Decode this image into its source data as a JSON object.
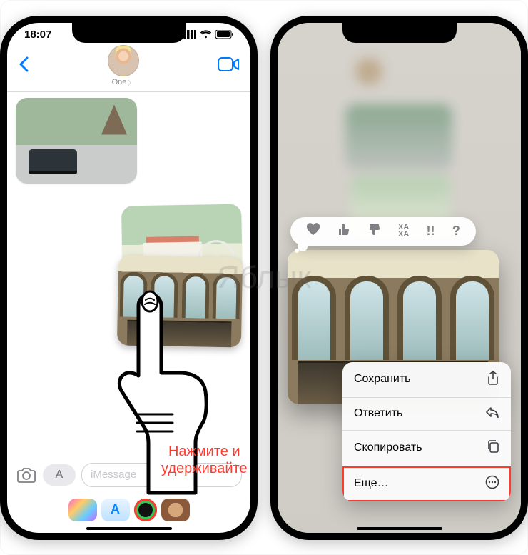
{
  "statusbar": {
    "time": "18:07"
  },
  "nav": {
    "contact_name": "One"
  },
  "input": {
    "placeholder": "iMessage"
  },
  "appstore_glyph": "A",
  "hint": {
    "line1": "Нажмите и",
    "line2": "удерживайте"
  },
  "tapback": {
    "haha": "XA\nXA",
    "emphasis": "!!",
    "question": "?"
  },
  "menu": {
    "save": "Сохранить",
    "reply": "Ответить",
    "copy": "Скопировать",
    "more": "Еще…"
  },
  "watermark": "Яблык"
}
